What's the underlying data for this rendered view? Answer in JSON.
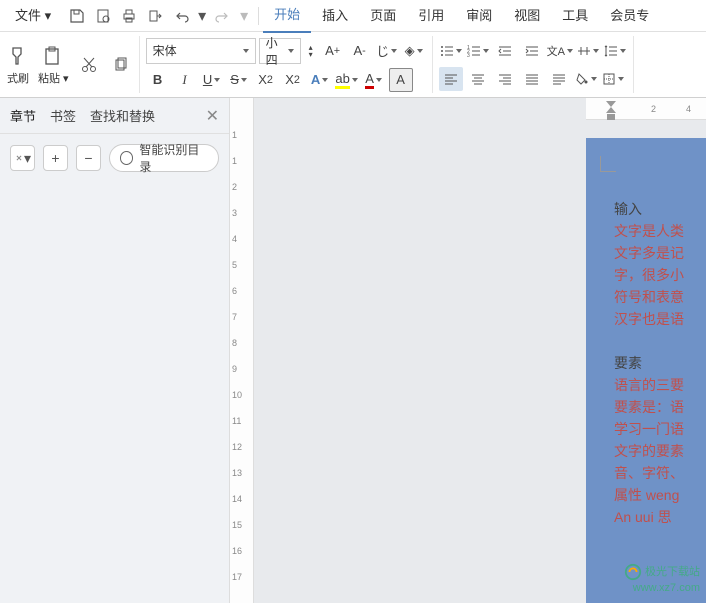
{
  "menubar": {
    "file": "文件",
    "items": [
      "开始",
      "插入",
      "页面",
      "引用",
      "审阅",
      "视图",
      "工具",
      "会员专"
    ]
  },
  "ribbon": {
    "clipboard": {
      "format_painter": "式刷",
      "paste": "粘贴"
    },
    "font": {
      "name": "宋体",
      "size": "小四"
    },
    "buttons": {
      "incFont": "A+",
      "decFont": "A-",
      "bold": "B",
      "italic": "I",
      "underline": "U",
      "strike": "S",
      "super": "X²",
      "sub": "X₂",
      "clear": "A"
    }
  },
  "sidebar": {
    "tabs": [
      "章节",
      "书签",
      "查找和替换"
    ],
    "smart_toc": "智能识别目录"
  },
  "ruler": {
    "v": [
      "1",
      "1",
      "2",
      "3",
      "4",
      "5",
      "6",
      "7",
      "8",
      "9",
      "10",
      "11",
      "12",
      "13",
      "14",
      "15",
      "16",
      "17"
    ],
    "h": [
      "2",
      "4"
    ]
  },
  "document": {
    "title": "输入",
    "lines": [
      "文字是人类",
      "文字多是记",
      "字，很多小",
      "符号和表意",
      "汉字也是语",
      "",
      "要素",
      "语言的三要",
      "要素是：语",
      "学习一门语",
      "文字的要素",
      "音、字符、",
      "属性 weng",
      "An uui 思"
    ]
  },
  "watermark": {
    "site": "极光下载站",
    "url": "www.xz7.com"
  }
}
